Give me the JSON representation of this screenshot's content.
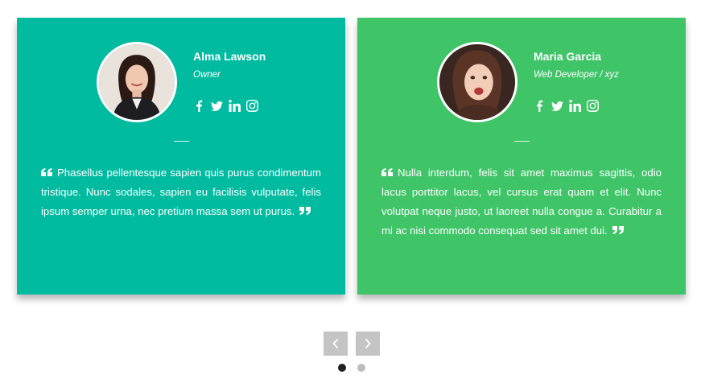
{
  "testimonials": [
    {
      "name": "Alma Lawson",
      "role": "Owner",
      "quote": "Phasellus pellentesque sapien quis purus condimentum tristique. Nunc sodales, sapien eu facilisis vulputate, felis ipsum semper urna, nec pretium massa sem ut purus.",
      "background": "#00bba0"
    },
    {
      "name": "Maria Garcia",
      "role": "Web Developer / xyz",
      "quote": "Nulla interdum, felis sit amet maximus sagittis, odio lacus porttitor lacus, vel cursus erat quam et elit. Nunc volutpat neque justo, ut laoreet nulla congue a. Curabitur a mi ac nisi commodo consequat sed sit amet dui.",
      "background": "#3fc468"
    }
  ],
  "social_icons": [
    "facebook-icon",
    "twitter-icon",
    "linkedin-icon",
    "instagram-icon"
  ],
  "carousel": {
    "prev_icon": "chevron-left-icon",
    "next_icon": "chevron-right-icon",
    "pages": 2,
    "active_page": 1
  }
}
